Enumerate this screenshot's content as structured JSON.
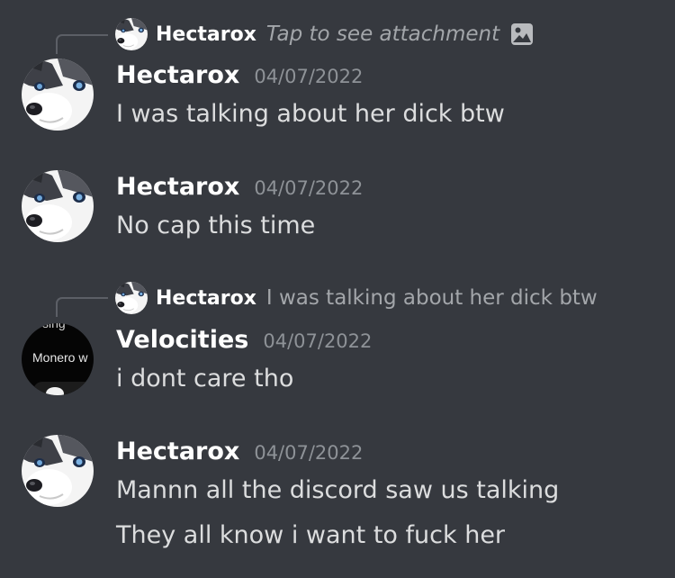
{
  "colors": {
    "background": "#36393f",
    "author": "#ffffff",
    "message_text": "#dcddde",
    "timestamp": "#8e9297",
    "reply_text": "#a3a6aa"
  },
  "messages": [
    {
      "reply": {
        "author": "Hectarox",
        "text": "Tap to see attachment",
        "icon": "image-icon"
      },
      "author": "Hectarox",
      "timestamp": "04/07/2022",
      "avatar": "husky-avatar",
      "lines": [
        "I was talking about her dick btw"
      ]
    },
    {
      "author": "Hectarox",
      "timestamp": "04/07/2022",
      "avatar": "husky-avatar",
      "lines": [
        "No cap this time"
      ]
    },
    {
      "reply": {
        "author": "Hectarox",
        "text": "I was talking about her dick btw"
      },
      "author": "Velocities",
      "timestamp": "04/07/2022",
      "avatar": "screenshot-avatar",
      "avatar_text": [
        "sing",
        "Monero w"
      ],
      "lines": [
        "i dont care tho"
      ]
    },
    {
      "author": "Hectarox",
      "timestamp": "04/07/2022",
      "avatar": "husky-avatar",
      "lines": [
        "Mannn all the discord saw us talking",
        "They all know i want to fuck her"
      ]
    }
  ]
}
